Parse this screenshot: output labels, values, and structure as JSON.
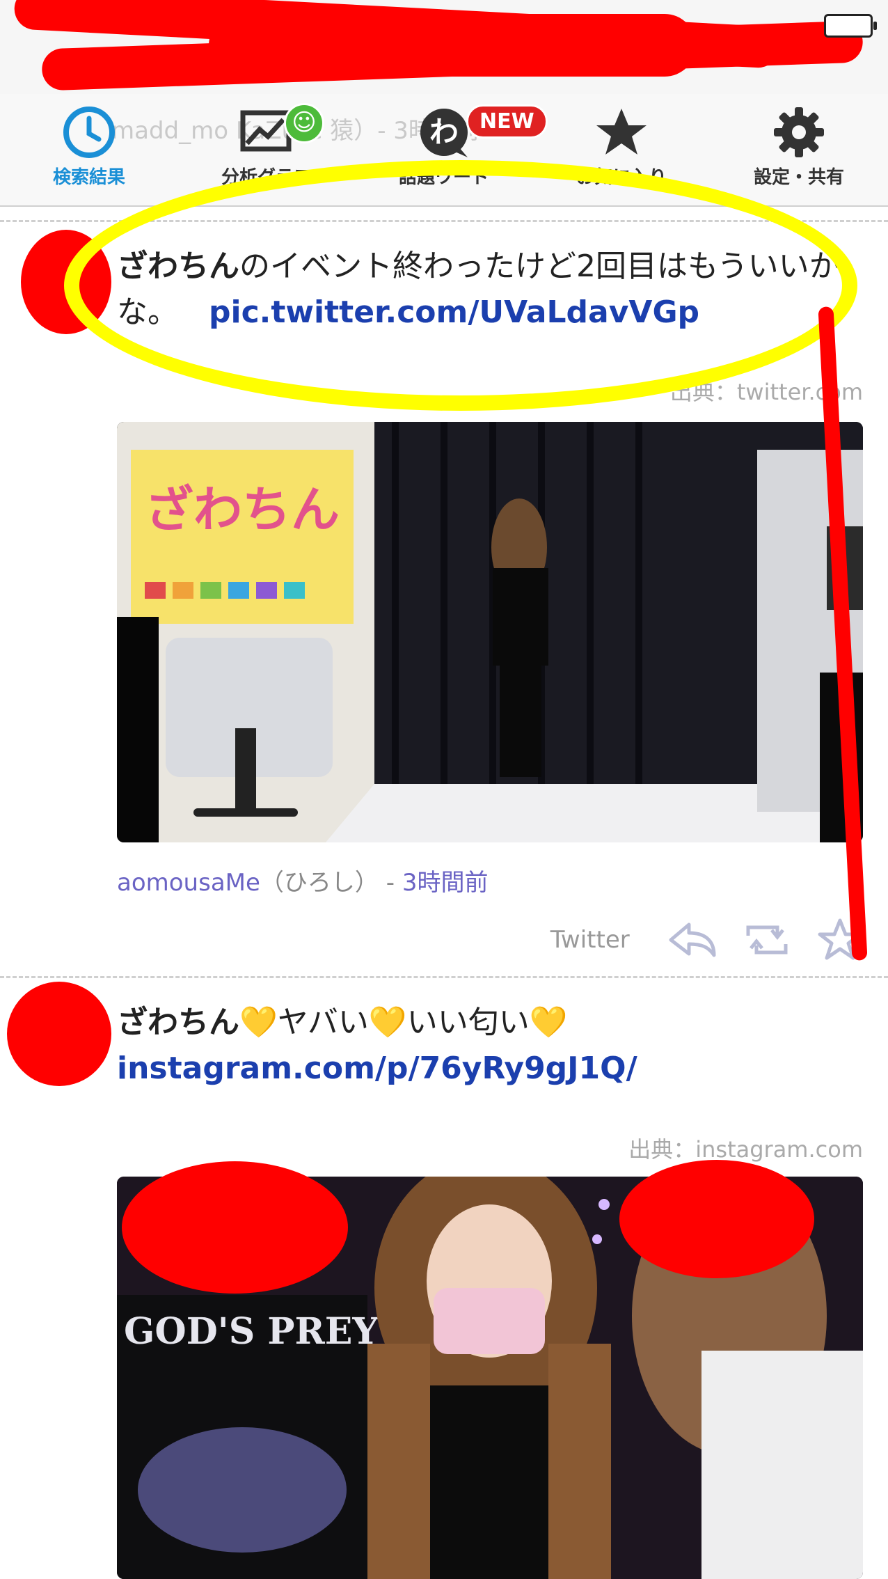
{
  "tabs": [
    {
      "label": "検索結果",
      "icon": "clock-icon",
      "active": true
    },
    {
      "label": "分析グラフ",
      "icon": "chart-icon",
      "badge": "smile"
    },
    {
      "label": "話題ワード",
      "icon": "wa-icon",
      "badge": "NEW"
    },
    {
      "label": "お気に入り",
      "icon": "star-icon"
    },
    {
      "label": "設定・共有",
      "icon": "gear-icon"
    }
  ],
  "ghost_text": "madd_mo  KaZuYe   猿）- 3時間前",
  "posts": [
    {
      "text_bold": "ざわちん",
      "text": "のイベント終わったけど2回目はもういいかな。",
      "link": "pic.twitter.com/UVaLdavVGp",
      "source": "出典：twitter.com",
      "user": "aomousaMe",
      "user_paren": "（ひろし）",
      "separator": " - ",
      "time": "3時間前",
      "service": "Twitter"
    },
    {
      "text_bold": "ざわちん",
      "text": "💛ヤバい💛いい匂い💛 ",
      "link": "instagram.com/p/76yRy9gJ1Q/",
      "source": "出典：instagram.com"
    }
  ],
  "colors": {
    "accent": "#1a8fd6",
    "link": "#1b3fae",
    "redact": "#ff0000",
    "highlight": "#ffff00"
  }
}
